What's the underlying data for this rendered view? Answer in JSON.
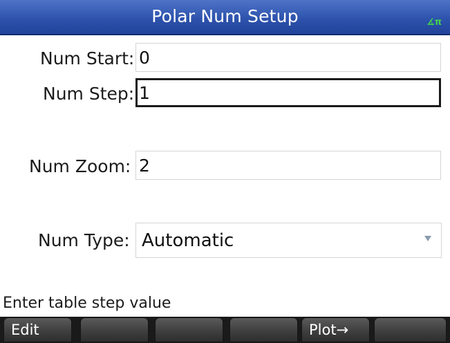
{
  "title": "Polar Num Setup",
  "angle_indicator": "∡π",
  "fields": {
    "num_start": {
      "label": "Num Start:",
      "value": "0"
    },
    "num_step": {
      "label": "Num Step:",
      "value": "1"
    },
    "num_zoom": {
      "label": "Num Zoom:",
      "value": "2"
    },
    "num_type": {
      "label": "Num Type:",
      "value": "Automatic"
    }
  },
  "status_message": "Enter table step value",
  "softkeys": [
    "Edit",
    "",
    "",
    "",
    "Plot→",
    ""
  ],
  "colors": {
    "title_bar": "#2e53ad",
    "angle_indicator": "#41d34a",
    "softkey": "#3f3f3f"
  }
}
